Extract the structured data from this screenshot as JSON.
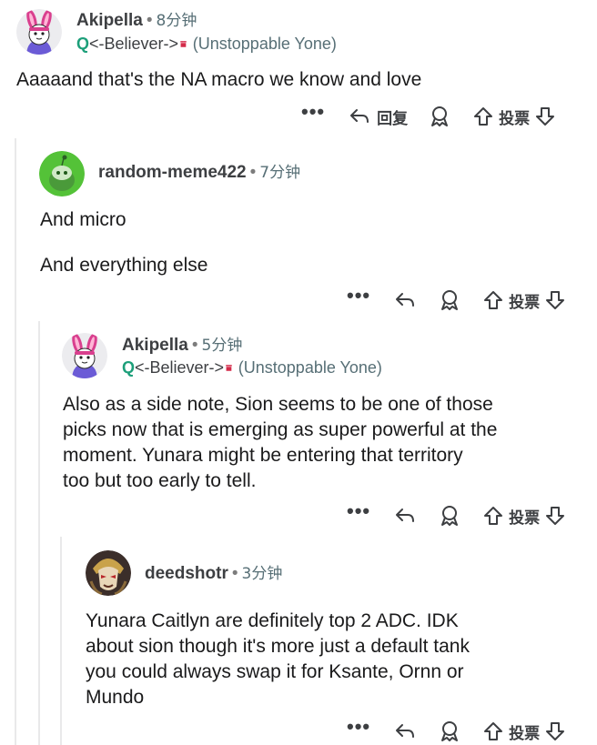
{
  "comments": [
    {
      "username": "Akipella",
      "time": "8分钟",
      "flair": {
        "prefix": "Q",
        "tag": "<-Believer->",
        "mark": "⩸",
        "text": "(Unstoppable Yone)"
      },
      "paragraphs": [
        "Aaaaand that's the NA macro we know and love"
      ],
      "actions": {
        "more": "•••",
        "reply": "回复",
        "vote": "投票"
      }
    },
    {
      "username": "random-meme422",
      "time": "7分钟",
      "paragraphs": [
        "And micro",
        "And everything else"
      ],
      "actions": {
        "more": "•••",
        "vote": "投票"
      }
    },
    {
      "username": "Akipella",
      "time": "5分钟",
      "flair": {
        "prefix": "Q",
        "tag": "<-Believer->",
        "mark": "⩸",
        "text": "(Unstoppable Yone)"
      },
      "paragraphs": [
        "Also as a side note, Sion seems to be one of those",
        "picks now that is emerging as super powerful at the",
        "moment. Yunara might be entering that territory",
        "too but too early to tell."
      ],
      "actions": {
        "more": "•••",
        "vote": "投票"
      }
    },
    {
      "username": "deedshotr",
      "time": "3分钟",
      "paragraphs": [
        "Yunara Caitlyn are definitely top 2 ADC. IDK",
        "about sion though it's more just a default tank",
        "you could always swap it for Ksante, Ornn or",
        "Mundo"
      ],
      "actions": {
        "more": "•••",
        "vote": "投票"
      }
    }
  ],
  "icons": [
    "reply-icon",
    "award-icon",
    "upvote-icon",
    "downvote-icon",
    "more-icon"
  ],
  "colors": {
    "username": "#3d3f42",
    "meta": "#576f76",
    "flair_q": "#1d9f7a",
    "flair_mark": "#d42b4a",
    "thread_line": "#e9e9ea"
  }
}
